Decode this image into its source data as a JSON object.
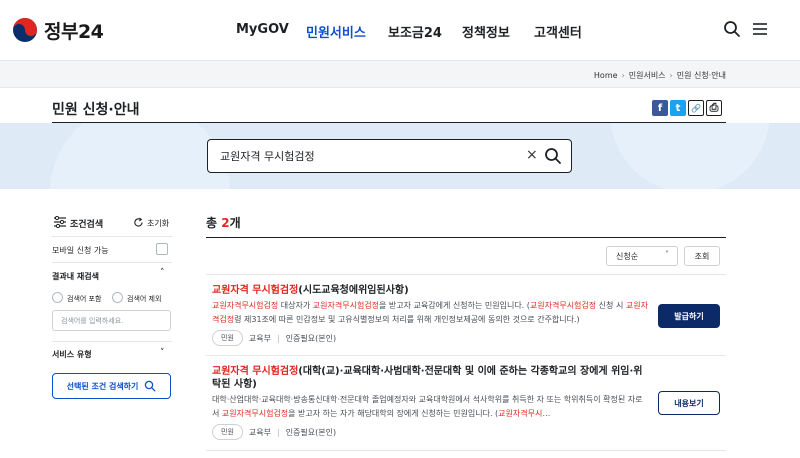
{
  "header": {
    "logo_text": "정부24",
    "nav": [
      "MyGOV",
      "민원서비스",
      "보조금24",
      "정책정보",
      "고객센터"
    ],
    "active_nav": "민원서비스"
  },
  "breadcrumb": [
    "Home",
    "민원서비스",
    "민원 신청·안내"
  ],
  "page": {
    "title": "민원 신청·안내"
  },
  "share": {
    "facebook": "f",
    "twitter": "t",
    "link": "🔗",
    "print": "⎙"
  },
  "search": {
    "value": "교원자격 무시험검정",
    "clear": "×"
  },
  "sidebar": {
    "title": "조건검색",
    "reset": "초기화",
    "mobile_label": "모바일 신청 가능",
    "refine_label": "결과내 재검색",
    "include_label": "검색어 포함",
    "exclude_label": "검색어 제외",
    "input_placeholder": "검색어를 입력하세요.",
    "service_type_label": "서비스 유형",
    "apply_button": "선택된 조건 검색하기"
  },
  "results": {
    "total_prefix": "총 ",
    "total_count": "2",
    "total_suffix": "개",
    "sort_value": "신청순",
    "query_button": "조회",
    "items": [
      {
        "title_hl": "교원자격 무시험검정",
        "title_rest": "(시도교육청에위임된사항)",
        "desc": [
          {
            "t": "교원자격무시험검정",
            "hl": true
          },
          {
            "t": " 대상자가 ",
            "hl": false
          },
          {
            "t": "교원자격무시험검정",
            "hl": true
          },
          {
            "t": "을 받고자 교육감에게 신청하는 민원입니다. (",
            "hl": false
          },
          {
            "t": "교원자격무시험검정",
            "hl": true
          },
          {
            "t": " 신청 시 ",
            "hl": false
          },
          {
            "t": "교원자격검정",
            "hl": true
          },
          {
            "t": "령 제31조에 따른 민감정보 및 고유식별정보의 처리를 위해 개인정보제공에 동의한 것으로 간주합니다.)",
            "hl": false
          }
        ],
        "tag": "민원",
        "org": "교육부",
        "auth": "인증필요(본인)",
        "button": "발급하기",
        "button_style": "primary"
      },
      {
        "title_hl": "교원자격 무시험검정",
        "title_rest": "(대학(교)·교육대학·사범대학·전문대학 및 이에 준하는 각종학교의 장에게 위임·위탁된 사항)",
        "desc": [
          {
            "t": "대학·산업대학·교육대학·방송통신대학·전문대학 졸업예정자와 교육대학원에서 석사학위를 취득한 자 또는 학위취득이 확정된 자로서 ",
            "hl": false
          },
          {
            "t": "교원자격무시험검정",
            "hl": true
          },
          {
            "t": "을 받고자 하는 자가 해당대학의 장에게 신청하는 민원입니다. (",
            "hl": false
          },
          {
            "t": "교원자격무시…",
            "hl": true
          }
        ],
        "tag": "민원",
        "org": "교육부",
        "auth": "인증필요(본인)",
        "button": "내용보기",
        "button_style": "outline"
      }
    ]
  },
  "colors": {
    "accent": "#0b50d0",
    "highlight": "#e0271f",
    "navy": "#0c2a68",
    "band": "#deebf7"
  }
}
